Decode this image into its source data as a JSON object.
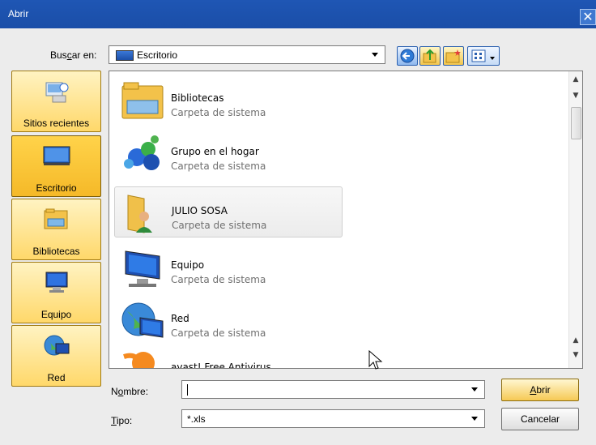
{
  "window": {
    "title": "Abrir",
    "close_glyph": "✕"
  },
  "lookin": {
    "label_pre": "Bus",
    "label_u": "c",
    "label_post": "ar en:",
    "value": "Escritorio",
    "icon": "monitor-icon"
  },
  "toolbar": {
    "buttons": [
      "back-icon",
      "up-folder-icon",
      "new-folder-icon",
      "view-menu-icon"
    ]
  },
  "places": [
    {
      "label": "Sitios recientes",
      "icon": "recent-places-icon",
      "selected": false
    },
    {
      "label": "Escritorio",
      "icon": "desktop-icon",
      "selected": true
    },
    {
      "label": "Bibliotecas",
      "icon": "libraries-icon",
      "selected": false
    },
    {
      "label": "Equipo",
      "icon": "computer-icon",
      "selected": false
    },
    {
      "label": "Red",
      "icon": "network-icon",
      "selected": false
    }
  ],
  "files": [
    {
      "name": "Bibliotecas",
      "desc": "Carpeta de sistema",
      "icon": "libraries-icon"
    },
    {
      "name": "Grupo en el hogar",
      "desc": "Carpeta de sistema",
      "icon": "homegroup-icon"
    },
    {
      "name": "JULIO SOSA",
      "desc": "Carpeta de sistema",
      "icon": "user-folder-icon"
    },
    {
      "name": "Equipo",
      "desc": "Carpeta de sistema",
      "icon": "computer-icon"
    },
    {
      "name": "Red",
      "desc": "Carpeta de sistema",
      "icon": "network-icon"
    },
    {
      "name": "avast! Free Antivirus",
      "desc": "",
      "icon": "avast-icon"
    }
  ],
  "filename": {
    "label_pre": "N",
    "label_u": "o",
    "label_post": "mbre:",
    "value": ""
  },
  "filetype": {
    "label_pre": "",
    "label_u": "T",
    "label_post": "ipo:",
    "value": "*.xls"
  },
  "buttons": {
    "open_u": "A",
    "open_rest": "brir",
    "cancel": "Cancelar"
  },
  "colors": {
    "titlebar": "#1f56b4",
    "place_selected": "#f5b928",
    "button_accent": "#f6c955"
  }
}
